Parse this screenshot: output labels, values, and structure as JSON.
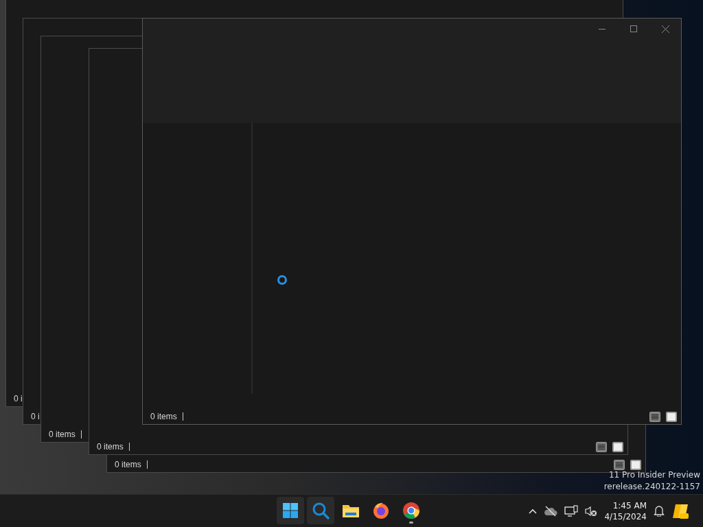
{
  "windows": [
    {
      "kind": "plain",
      "status": "0 i"
    },
    {
      "kind": "plain",
      "status": "0 i"
    },
    {
      "kind": "plain",
      "status": "0 items"
    },
    {
      "kind": "views",
      "status": "0 items"
    },
    {
      "kind": "views",
      "status": "0 items"
    },
    {
      "kind": "front",
      "status": "0 items"
    }
  ],
  "watermark": [
    "11 Pro Insider Preview",
    "rerelease.240122-1157"
  ],
  "taskbar": {
    "apps": [
      {
        "kind": "start",
        "running": false
      },
      {
        "kind": "search",
        "running": false
      },
      {
        "kind": "explorer",
        "running": false
      },
      {
        "kind": "firefox",
        "running": false
      },
      {
        "kind": "chrome",
        "running": true
      }
    ],
    "clock": {
      "time": "1:45 AM",
      "date": "4/15/2024"
    }
  }
}
